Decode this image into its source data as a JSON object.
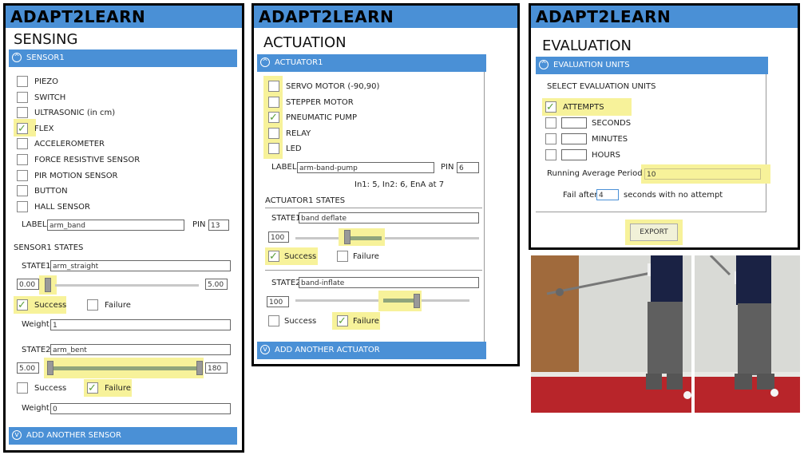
{
  "brand": "ADAPT2LEARN",
  "sensing": {
    "heading": "SENSING",
    "section_label": "SENSOR1",
    "sensor_types": [
      "PIEZO",
      "SWITCH",
      "ULTRASONIC (in cm)",
      "FLEX",
      "ACCELEROMETER",
      "FORCE RESISTIVE SENSOR",
      "PIR MOTION SENSOR",
      "BUTTON",
      "HALL SENSOR"
    ],
    "selected_sensor": "FLEX",
    "label_caption": "LABEL",
    "label_value": "arm_band",
    "pin_caption": "PIN",
    "pin_value": "13",
    "states_heading": "SENSOR1 STATES",
    "state1": {
      "caption": "STATE1",
      "name": "arm_straight",
      "min": "0.00",
      "max": "5.00",
      "success": "Success",
      "failure": "Failure",
      "selected": "Success",
      "weight_caption": "Weight",
      "weight": "1"
    },
    "state2": {
      "caption": "STATE2",
      "name": "arm_bent",
      "min": "5.00",
      "max": "180",
      "success": "Success",
      "failure": "Failure",
      "selected": "Failure",
      "weight_caption": "Weight",
      "weight": "0"
    },
    "add_label": "ADD ANOTHER SENSOR"
  },
  "actuation": {
    "heading": "ACTUATION",
    "section_label": "ACTUATOR1",
    "actuator_types": [
      "SERVO MOTOR (-90,90)",
      "STEPPER MOTOR",
      "PNEUMATIC PUMP",
      "RELAY",
      "LED"
    ],
    "selected_actuator": "PNEUMATIC PUMP",
    "label_caption": "LABEL",
    "label_value": "arm-band-pump",
    "pin_caption": "PIN",
    "pin_value": "6",
    "pin_note": "In1: 5, In2: 6, EnA at 7",
    "states_heading": "ACTUATOR1 STATES",
    "state1": {
      "caption": "STATE1",
      "name": "band deflate",
      "value": "100",
      "success": "Success",
      "failure": "Failure",
      "selected": "Success"
    },
    "state2": {
      "caption": "STATE2",
      "name": "band-inflate",
      "value": "100",
      "success": "Success",
      "failure": "Failure",
      "selected": "Failure"
    },
    "add_label": "ADD ANOTHER ACTUATOR"
  },
  "evaluation": {
    "heading": "EVALUATION",
    "section_label": "EVALUATION UNITS",
    "select_caption": "SELECT EVALUATION UNITS",
    "units": [
      "ATTEMPTS",
      "SECONDS",
      "MINUTES",
      "HOURS"
    ],
    "selected_unit": "ATTEMPTS",
    "running_avg_caption": "Running Average Period",
    "running_avg_value": "10",
    "fail_after_caption": "Fail after",
    "fail_after_value": "4",
    "fail_after_suffix": "seconds with no attempt",
    "export_label": "EXPORT"
  }
}
